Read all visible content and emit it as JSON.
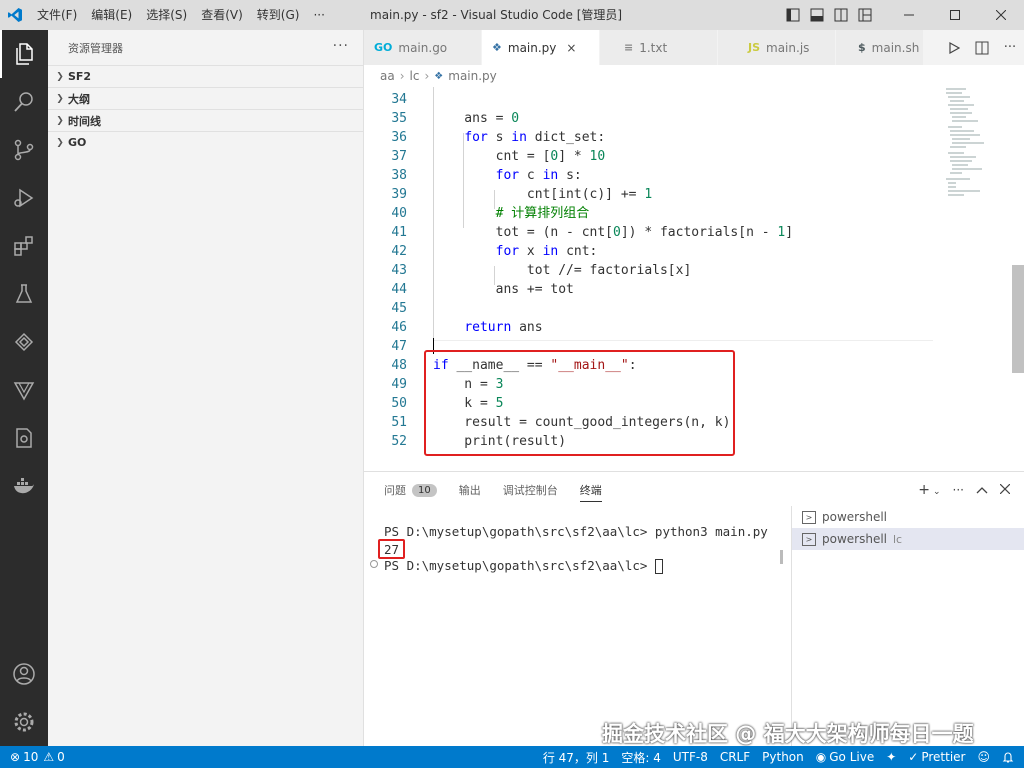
{
  "titlebar": {
    "title": "main.py - sf2 - Visual Studio Code [管理员]",
    "menu": [
      "文件(F)",
      "编辑(E)",
      "选择(S)",
      "查看(V)",
      "转到(G)",
      "···"
    ]
  },
  "sidebar": {
    "title": "资源管理器",
    "sections": [
      "SF2",
      "大纲",
      "时间线",
      "GO"
    ]
  },
  "tabs": [
    {
      "label": "main.go",
      "icon": "go-icon",
      "icon_text": "GO"
    },
    {
      "label": "main.py",
      "icon": "python-icon",
      "icon_text": "❖",
      "close": "×"
    },
    {
      "label": "1.txt",
      "icon": "text-file-icon",
      "icon_text": "≡"
    },
    {
      "label": "main.js",
      "icon": "js-icon",
      "icon_text": "JS"
    },
    {
      "label": "main.sh",
      "icon": "shell-icon",
      "icon_text": "$"
    }
  ],
  "breadcrumb": [
    "aa",
    "lc",
    "main.py"
  ],
  "code": {
    "line_numbers": [
      "34",
      "35",
      "36",
      "37",
      "38",
      "39",
      "40",
      "41",
      "42",
      "43",
      "44",
      "45",
      "46",
      "47",
      "48",
      "49",
      "50",
      "51",
      "52"
    ]
  },
  "panel": {
    "tabs": [
      "问题",
      "输出",
      "调试控制台",
      "终端"
    ],
    "problems_badge": "10",
    "terminal_lines": [
      "PS D:\\mysetup\\gopath\\src\\sf2\\aa\\lc> python3 main.py",
      "27",
      "PS D:\\mysetup\\gopath\\src\\sf2\\aa\\lc> "
    ],
    "terminals": [
      {
        "name": "powershell",
        "sub": ""
      },
      {
        "name": "powershell",
        "sub": "lc"
      }
    ]
  },
  "watermark": "掘金技术社区 @ 福大大架构师每日一题",
  "statusbar": {
    "errors": "10",
    "warnings": "0",
    "position": "行 47，列 1",
    "spaces": "空格: 4",
    "encoding": "UTF-8",
    "eol": "CRLF",
    "language": "Python",
    "golive": "Go Live",
    "prettier": "Prettier"
  },
  "colors": {
    "accent": "#007acc",
    "highlight_box": "#e02020"
  }
}
